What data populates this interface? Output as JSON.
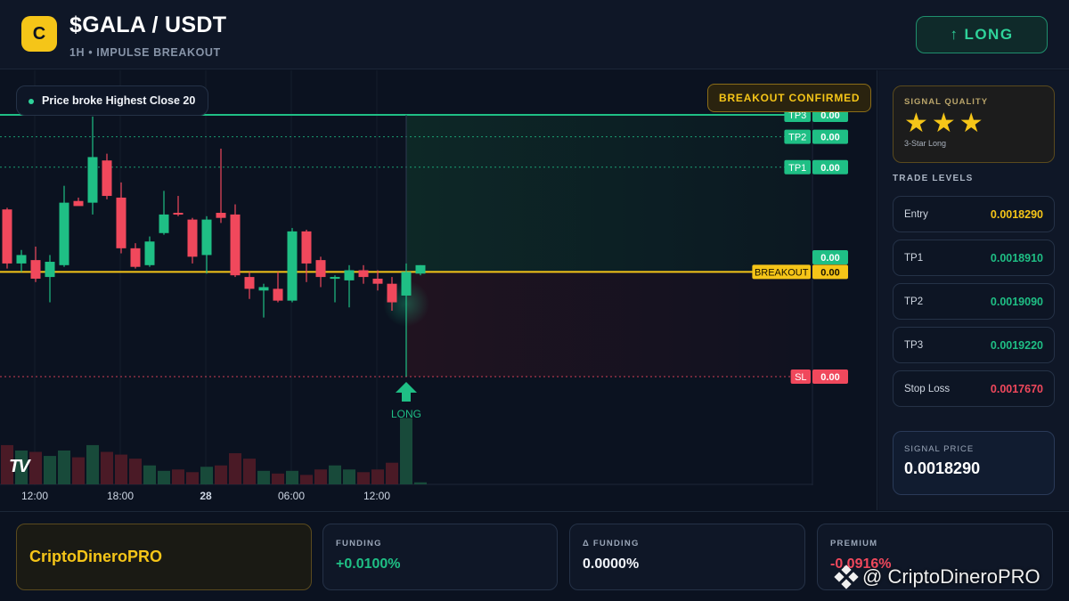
{
  "header": {
    "logo_letter": "C",
    "pair": "$GALA / USDT",
    "subtitle": "1H • IMPULSE BREAKOUT",
    "long_button": "LONG",
    "long_button_icon": "arrow-up-icon"
  },
  "chart": {
    "condition_badge": "Price broke Highest Close 20",
    "confirm_badge": "BREAKOUT CONFIRMED",
    "signal_marker": "LONG",
    "watermark_logo": "TV",
    "x_ticks": [
      "12:00",
      "18:00",
      "28",
      "06:00",
      "12:00"
    ],
    "level_tags": [
      {
        "name": "TP3",
        "value": "0.00",
        "color": "#1fbf85"
      },
      {
        "name": "TP2",
        "value": "0.00",
        "color": "#1fbf85"
      },
      {
        "name": "TP1",
        "value": "0.00",
        "color": "#1fbf85"
      },
      {
        "name": "",
        "value": "0.00",
        "color": "#1fbf85"
      },
      {
        "name": "BREAKOUT",
        "value": "0.00",
        "color": "#f5c518"
      },
      {
        "name": "SL",
        "value": "0.00",
        "color": "#f0485c"
      }
    ],
    "colors": {
      "up": "#1fbf85",
      "down": "#f0485c",
      "breakout": "#f5c518"
    }
  },
  "chart_data": {
    "type": "candlestick",
    "levels": {
      "tp3": 0.001922,
      "tp2": 0.001909,
      "tp1": 0.001891,
      "entry": 0.001829,
      "breakout": 0.001829,
      "sl": 0.001767
    },
    "candles": [
      {
        "o": 0.001866,
        "h": 0.001867,
        "l": 0.001831,
        "c": 0.001834
      },
      {
        "o": 0.001834,
        "h": 0.001842,
        "l": 0.001829,
        "c": 0.001839
      },
      {
        "o": 0.001836,
        "h": 0.001844,
        "l": 0.001823,
        "c": 0.001825
      },
      {
        "o": 0.001826,
        "h": 0.001839,
        "l": 0.001811,
        "c": 0.001835
      },
      {
        "o": 0.001833,
        "h": 0.00188,
        "l": 0.001832,
        "c": 0.00187
      },
      {
        "o": 0.001871,
        "h": 0.001873,
        "l": 0.001869,
        "c": 0.001868
      },
      {
        "o": 0.00187,
        "h": 0.001921,
        "l": 0.001863,
        "c": 0.001897
      },
      {
        "o": 0.001895,
        "h": 0.001899,
        "l": 0.001872,
        "c": 0.001874
      },
      {
        "o": 0.001873,
        "h": 0.001882,
        "l": 0.00184,
        "c": 0.001843
      },
      {
        "o": 0.001843,
        "h": 0.001846,
        "l": 0.001831,
        "c": 0.001832
      },
      {
        "o": 0.001833,
        "h": 0.00185,
        "l": 0.001832,
        "c": 0.001847
      },
      {
        "o": 0.001852,
        "h": 0.001877,
        "l": 0.001851,
        "c": 0.001863
      },
      {
        "o": 0.001864,
        "h": 0.001874,
        "l": 0.001862,
        "c": 0.001863
      },
      {
        "o": 0.00186,
        "h": 0.001861,
        "l": 0.001834,
        "c": 0.001838
      },
      {
        "o": 0.001839,
        "h": 0.001862,
        "l": 0.001828,
        "c": 0.00186
      },
      {
        "o": 0.001864,
        "h": 0.001902,
        "l": 0.001858,
        "c": 0.001861
      },
      {
        "o": 0.001863,
        "h": 0.001869,
        "l": 0.001826,
        "c": 0.001827
      },
      {
        "o": 0.001826,
        "h": 0.001829,
        "l": 0.001813,
        "c": 0.001819
      },
      {
        "o": 0.001818,
        "h": 0.001822,
        "l": 0.001802,
        "c": 0.00182
      },
      {
        "o": 0.001819,
        "h": 0.001829,
        "l": 0.001811,
        "c": 0.001812
      },
      {
        "o": 0.001812,
        "h": 0.001855,
        "l": 0.001811,
        "c": 0.001853
      },
      {
        "o": 0.001853,
        "h": 0.001854,
        "l": 0.001823,
        "c": 0.001834
      },
      {
        "o": 0.001836,
        "h": 0.001838,
        "l": 0.00182,
        "c": 0.001826
      },
      {
        "o": 0.001826,
        "h": 0.001827,
        "l": 0.001811,
        "c": 0.001826
      },
      {
        "o": 0.001824,
        "h": 0.001833,
        "l": 0.001808,
        "c": 0.00183
      },
      {
        "o": 0.00183,
        "h": 0.001833,
        "l": 0.001822,
        "c": 0.001826
      },
      {
        "o": 0.001825,
        "h": 0.00183,
        "l": 0.001818,
        "c": 0.001822
      },
      {
        "o": 0.001822,
        "h": 0.001826,
        "l": 0.001806,
        "c": 0.001811
      },
      {
        "o": 0.001815,
        "h": 0.001834,
        "l": 0.001767,
        "c": 0.001829
      },
      {
        "o": 0.001828,
        "h": 0.001833,
        "l": 0.001827,
        "c": 0.001833
      }
    ],
    "volumes": [
      58,
      50,
      48,
      42,
      50,
      40,
      58,
      48,
      44,
      38,
      28,
      20,
      22,
      18,
      26,
      28,
      46,
      38,
      20,
      16,
      20,
      14,
      22,
      28,
      22,
      18,
      22,
      32,
      98,
      3
    ]
  },
  "sidebar": {
    "quality_title": "SIGNAL QUALITY",
    "stars": "★★★",
    "quality_caption": "3-Star Long",
    "levels_title": "TRADE LEVELS",
    "levels": [
      {
        "label": "Entry",
        "value": "0.0018290",
        "color": "#f5c518"
      },
      {
        "label": "TP1",
        "value": "0.0018910",
        "color": "#1fbf85"
      },
      {
        "label": "TP2",
        "value": "0.0019090",
        "color": "#1fbf85"
      },
      {
        "label": "TP3",
        "value": "0.0019220",
        "color": "#1fbf85"
      },
      {
        "label": "Stop Loss",
        "value": "0.0017670",
        "color": "#f0485c"
      }
    ],
    "signal_price_label": "SIGNAL PRICE",
    "signal_price": "0.0018290"
  },
  "footer": {
    "brand": "CriptoDineroPRO",
    "funding_label": "FUNDING",
    "funding_value": "+0.0100%",
    "dfunding_label": "Δ FUNDING",
    "dfunding_value": "0.0000%",
    "premium_label": "PREMIUM",
    "premium_value": "-0.0916%",
    "watermark": "@ CriptoDineroPRO"
  }
}
